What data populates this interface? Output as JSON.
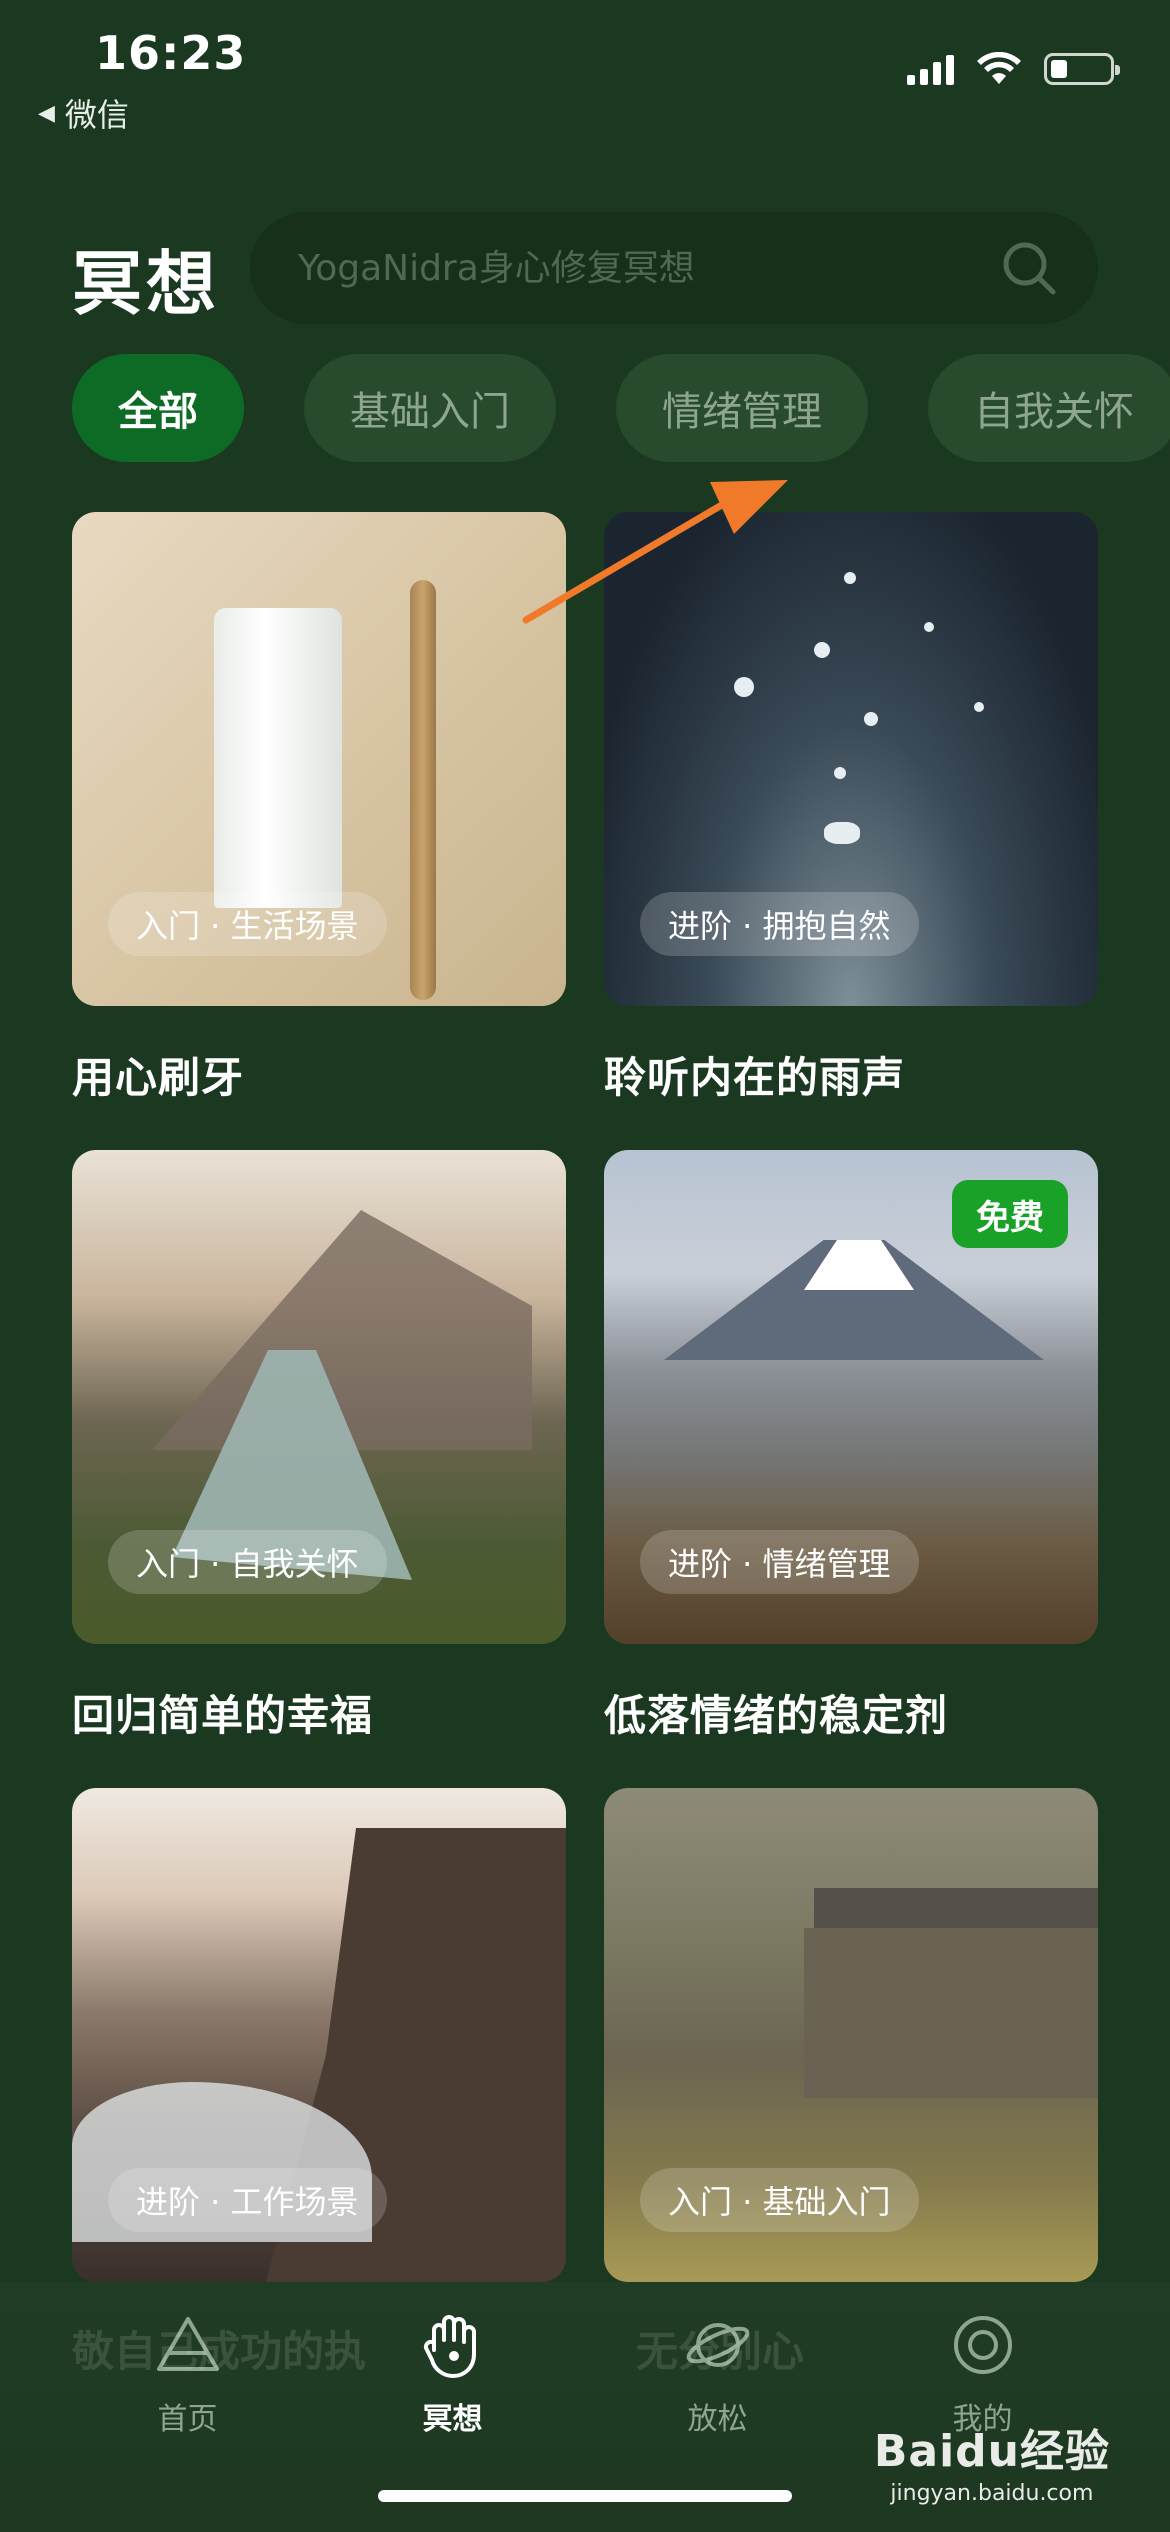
{
  "status_bar": {
    "time": "16:23",
    "back_app": "微信"
  },
  "header": {
    "title": "冥想",
    "search_placeholder": "YogaNidra身心修复冥想"
  },
  "tabs": [
    {
      "label": "全部",
      "active": true
    },
    {
      "label": "基础入门",
      "active": false
    },
    {
      "label": "情绪管理",
      "active": false
    },
    {
      "label": "自我关怀",
      "active": false
    }
  ],
  "cards": [
    {
      "title": "用心刷牙",
      "tag": "入门 · 生活场景",
      "image": "toothpaste-and-bamboo-toothbrush"
    },
    {
      "title": "聆听内在的雨声",
      "tag": "进阶 · 拥抱自然",
      "image": "water-droplets-splash"
    },
    {
      "title": "回归简单的幸福",
      "tag": "入门 · 自我关怀",
      "image": "woman-dancing-mountains"
    },
    {
      "title": "低落情绪的稳定剂",
      "tag": "进阶 · 情绪管理",
      "badge": "免费",
      "image": "mount-fuji-lake-photographer"
    },
    {
      "title": "",
      "tag": "进阶 · 工作场景",
      "image": "rocky-coast-waves"
    },
    {
      "title": "",
      "tag": "入门 · 基础入门",
      "image": "stone-farmhouse-field"
    }
  ],
  "ghost_titles": [
    "敬自己成功的执",
    "无分别心"
  ],
  "bottom_nav": [
    {
      "label": "首页",
      "icon": "triangle-icon",
      "active": false
    },
    {
      "label": "冥想",
      "icon": "hand-icon",
      "active": true
    },
    {
      "label": "放松",
      "icon": "planet-icon",
      "active": false
    },
    {
      "label": "我的",
      "icon": "target-icon",
      "active": false
    }
  ],
  "watermark": {
    "brand": "Baidu经验",
    "site": "jingyan.baidu.com"
  },
  "colors": {
    "background": "#1b3820",
    "accent": "#0e6b26",
    "free_badge": "#1aa128",
    "arrow": "#f07a2a"
  }
}
